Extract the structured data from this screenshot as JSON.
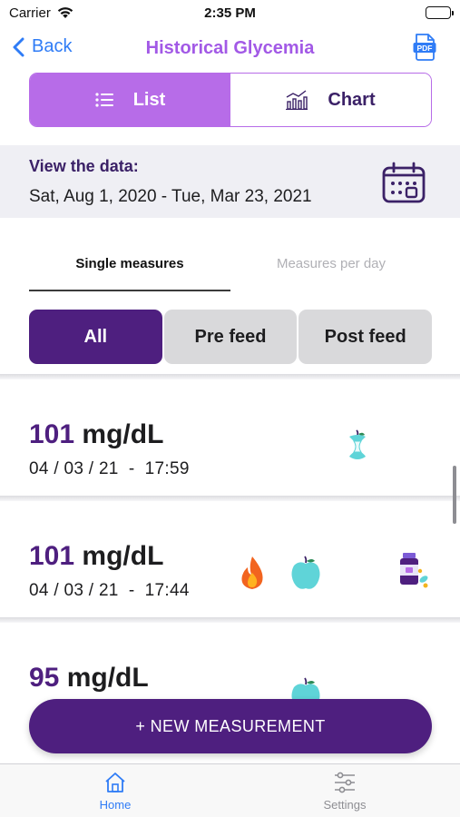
{
  "status_bar": {
    "carrier": "Carrier",
    "time": "2:35 PM"
  },
  "nav": {
    "back_label": "Back",
    "title": "Historical Glycemia",
    "pdf_label": "PDF"
  },
  "view_toggle": {
    "list_label": "List",
    "chart_label": "Chart",
    "selected": "List"
  },
  "date_range": {
    "label": "View the data:",
    "value": "Sat, Aug 1, 2020 - Tue, Mar 23, 2021"
  },
  "sub_tabs": {
    "single_label": "Single measures",
    "per_day_label": "Measures per day",
    "selected": "Single measures"
  },
  "filters": {
    "all_label": "All",
    "pre_label": "Pre feed",
    "post_label": "Post feed",
    "selected": "All"
  },
  "measurements": [
    {
      "value": "101",
      "unit": "mg/dL",
      "date": "04 / 03 / 21",
      "time": "17:59",
      "icons": [
        "apple-core-icon"
      ]
    },
    {
      "value": "101",
      "unit": "mg/dL",
      "date": "04 / 03 / 21",
      "time": "17:44",
      "icons": [
        "flame-icon",
        "apple-icon",
        "medication-icon"
      ]
    },
    {
      "value": "95",
      "unit": "mg/dL",
      "date": "",
      "time": "",
      "icons": [
        "apple-icon"
      ]
    }
  ],
  "new_button_label": "+ NEW MEASUREMENT",
  "tab_bar": {
    "home_label": "Home",
    "settings_label": "Settings",
    "selected": "Home"
  },
  "colors": {
    "accent_purple": "#b76ce8",
    "deep_purple": "#4e1f7f",
    "ios_blue": "#2f7cf6",
    "teal": "#5fd4d8"
  }
}
